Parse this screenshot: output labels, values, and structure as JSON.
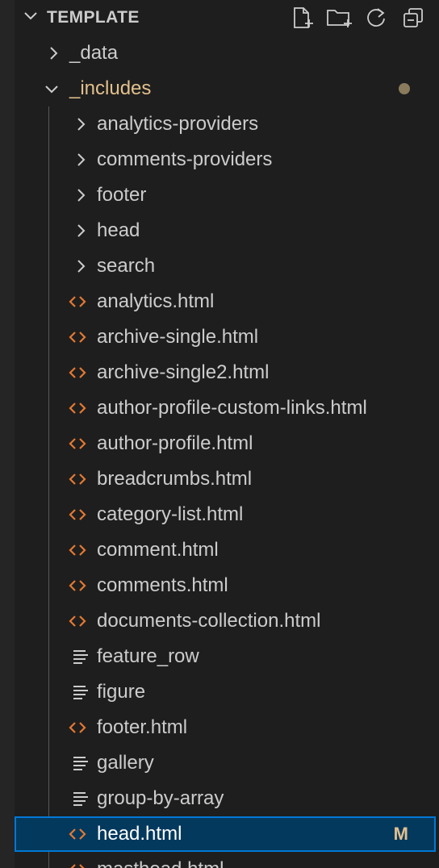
{
  "explorer": {
    "section_title": "TEMPLATE",
    "actions": [
      {
        "name": "new-file-icon"
      },
      {
        "name": "new-folder-icon"
      },
      {
        "name": "refresh-icon"
      },
      {
        "name": "collapse-all-icon"
      }
    ]
  },
  "tree": {
    "data_folder": "_data",
    "includes_folder": "_includes",
    "includes_badge": "dot",
    "children": [
      {
        "label": "analytics-providers",
        "kind": "folder"
      },
      {
        "label": "comments-providers",
        "kind": "folder"
      },
      {
        "label": "footer",
        "kind": "folder"
      },
      {
        "label": "head",
        "kind": "folder"
      },
      {
        "label": "search",
        "kind": "folder"
      },
      {
        "label": "analytics.html",
        "kind": "html"
      },
      {
        "label": "archive-single.html",
        "kind": "html"
      },
      {
        "label": "archive-single2.html",
        "kind": "html"
      },
      {
        "label": "author-profile-custom-links.html",
        "kind": "html"
      },
      {
        "label": "author-profile.html",
        "kind": "html"
      },
      {
        "label": "breadcrumbs.html",
        "kind": "html"
      },
      {
        "label": "category-list.html",
        "kind": "html"
      },
      {
        "label": "comment.html",
        "kind": "html"
      },
      {
        "label": "comments.html",
        "kind": "html"
      },
      {
        "label": "documents-collection.html",
        "kind": "html"
      },
      {
        "label": "feature_row",
        "kind": "text"
      },
      {
        "label": "figure",
        "kind": "text"
      },
      {
        "label": "footer.html",
        "kind": "html"
      },
      {
        "label": "gallery",
        "kind": "text"
      },
      {
        "label": "group-by-array",
        "kind": "text"
      },
      {
        "label": "head.html",
        "kind": "html",
        "selected": true,
        "status": "M"
      },
      {
        "label": "masthead.html",
        "kind": "html"
      }
    ]
  },
  "colors": {
    "html_icon": "#e37933",
    "modified": "#e2c08d",
    "selection_bg": "#04395e",
    "selection_border": "#0078d4"
  }
}
